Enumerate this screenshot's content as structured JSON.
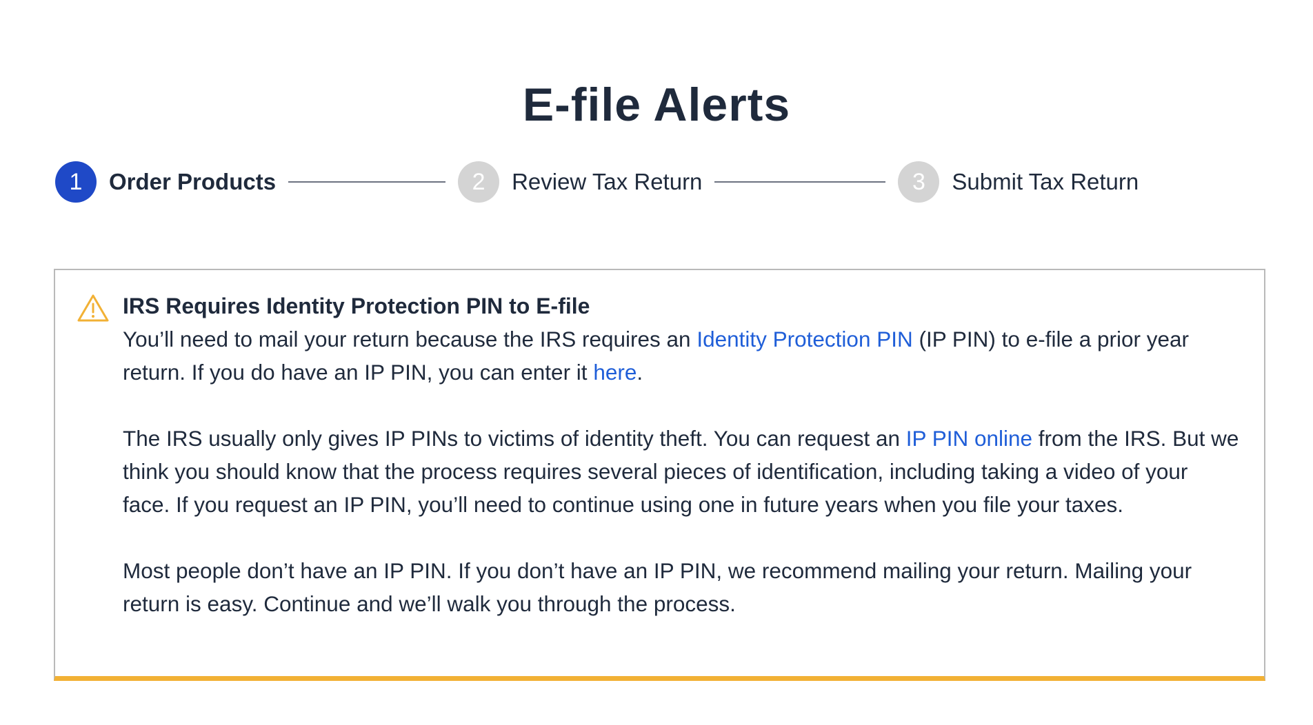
{
  "page": {
    "title": "E-file Alerts"
  },
  "stepper": {
    "steps": [
      {
        "number": "1",
        "label": "Order Products",
        "state": "active"
      },
      {
        "number": "2",
        "label": "Review Tax Return",
        "state": "inactive"
      },
      {
        "number": "3",
        "label": "Submit Tax Return",
        "state": "inactive"
      }
    ]
  },
  "alert": {
    "icon": "warning-triangle-icon",
    "accent_color": "#f2b135",
    "title": "IRS Requires Identity Protection PIN to E-file",
    "p1": {
      "text_a": "You’ll need to mail your return because the IRS requires an ",
      "link_a": "Identity Protection PIN",
      "text_b": " (IP PIN) to e-file a prior year return. If you do have an IP PIN, you can enter it ",
      "link_b": "here",
      "text_c": "."
    },
    "p2": {
      "text_a": "The IRS usually only gives IP PINs to victims of identity theft. You can request an ",
      "link_a": "IP PIN online",
      "text_b": " from the IRS. But we think you should know that the process requires several pieces of identification, including taking a video of your face. If you request an IP PIN, you’ll need to continue using one in future years when you file your taxes."
    },
    "p3": {
      "text": "Most people don’t have an IP PIN. If you don’t have an IP PIN, we recommend mailing your return. Mailing your return is easy. Continue and we’ll walk you through the process."
    }
  },
  "colors": {
    "primary": "#1f49c7",
    "link": "#1f5ed8",
    "text": "#1f2a3c",
    "inactive_step": "#d4d4d4",
    "warning": "#f2b135"
  }
}
